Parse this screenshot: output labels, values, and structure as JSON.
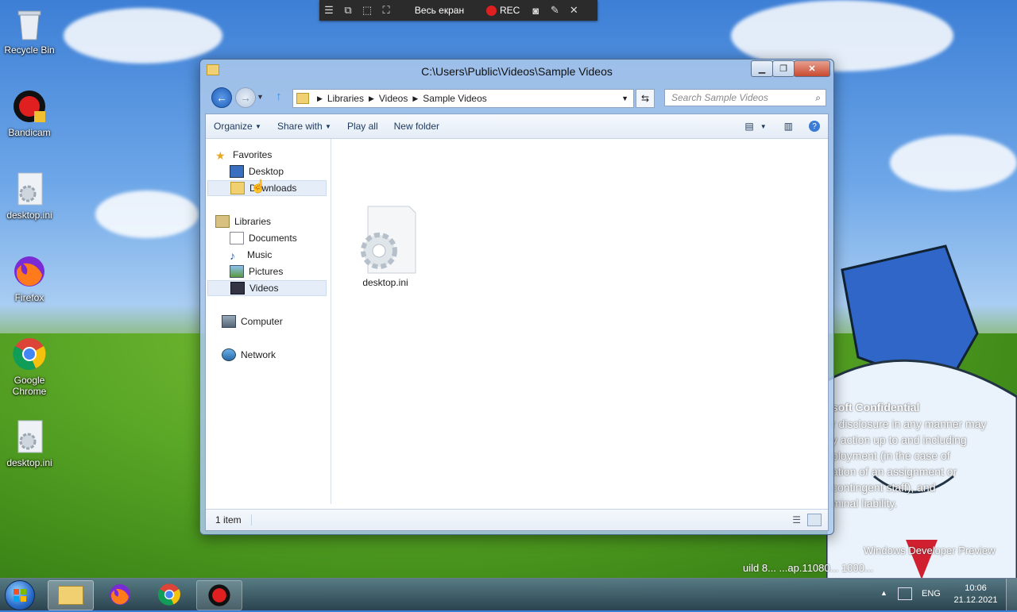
{
  "desktop": {
    "icons": [
      {
        "label": "Recycle Bin",
        "icon": "recycle-bin-icon"
      },
      {
        "label": "Bandicam",
        "icon": "bandicam-icon"
      },
      {
        "label": "desktop.ini",
        "icon": "settings-file-icon"
      },
      {
        "label": "Firefox",
        "icon": "firefox-icon"
      },
      {
        "label": "Google Chrome",
        "icon": "chrome-icon"
      },
      {
        "label": "desktop.ini",
        "icon": "settings-file-icon"
      }
    ],
    "watermark": {
      "line1": "soft Confidential",
      "line2": "r disclosure in any manner may",
      "line3": "y action up to and including",
      "line4": "ployment (in the case of",
      "line5": "ation of an assignment or",
      "line6": "contingent staff), and",
      "line7": "minal liability.",
      "build1": "Windows Developer Preview",
      "build2": "uild 8... ...ap.11080... 1000..."
    }
  },
  "recorder": {
    "mode": "Весь екран",
    "rec_label": "REC"
  },
  "window": {
    "title": "C:\\Users\\Public\\Videos\\Sample Videos",
    "address": {
      "crumbs": [
        "Libraries",
        "Videos",
        "Sample Videos"
      ]
    },
    "search_placeholder": "Search Sample Videos",
    "toolbar": {
      "organize": "Organize",
      "share_with": "Share with",
      "play_all": "Play all",
      "new_folder": "New folder"
    },
    "nav": {
      "favorites": "Favorites",
      "desktop": "Desktop",
      "downloads": "Downloads",
      "libraries": "Libraries",
      "documents": "Documents",
      "music": "Music",
      "pictures": "Pictures",
      "videos": "Videos",
      "computer": "Computer",
      "network": "Network"
    },
    "files": [
      {
        "name": "desktop.ini",
        "icon": "settings-file-icon"
      }
    ],
    "status": "1 item"
  },
  "taskbar": {
    "lang": "ENG",
    "time": "10:06",
    "date": "21.12.2021",
    "pinned": [
      "windows-explorer-icon",
      "firefox-icon",
      "chrome-icon",
      "bandicam-icon"
    ]
  },
  "colors": {
    "accent": "#3a7bd5",
    "rec": "#e02020"
  }
}
